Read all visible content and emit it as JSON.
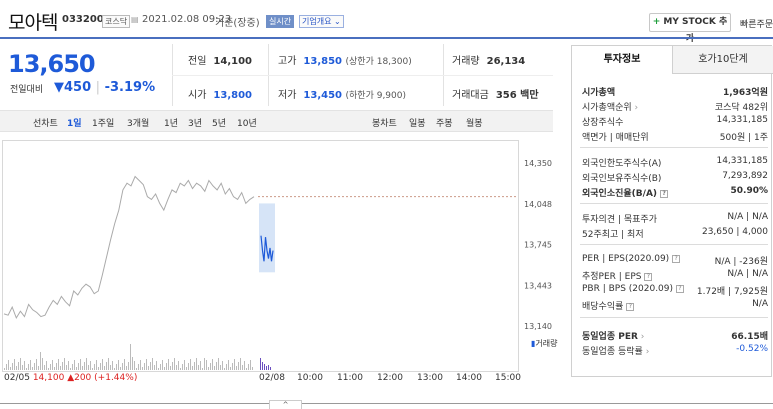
{
  "header": {
    "name": "모아텍",
    "code": "033200",
    "market_badge": "코스닥",
    "datetime": "2021.02.08 09:23",
    "basis": "기준(장중)",
    "realtime_badge": "실시간",
    "overview_badge": "기업개요",
    "my_stock_label": "MY STOCK 추가",
    "quick_order_label": "빠른주문"
  },
  "quote": {
    "price": "13,650",
    "change_label": "전일대비",
    "change_arrow": "▼",
    "change_amount": "450",
    "change_pct": "-3.19%",
    "prev_close_label": "전일",
    "prev_close": "14,100",
    "open_label": "시가",
    "open": "13,800",
    "high_label": "고가",
    "high": "13,850",
    "upper_limit": "(상한가 18,300)",
    "low_label": "저가",
    "low": "13,450",
    "lower_limit": "(하한가 9,900)",
    "volume_label": "거래량",
    "volume": "26,134",
    "amount_label": "거래대금",
    "amount": "356 백만"
  },
  "chart_tabs": {
    "line_label": "선차트",
    "periods": [
      "1일",
      "1주일",
      "3개월",
      "1년",
      "3년",
      "5년",
      "10년"
    ],
    "candle_label": "봉차트",
    "candles": [
      "일봉",
      "주봉",
      "월봉"
    ]
  },
  "chart_data": {
    "type": "line",
    "y_ticks": [
      "14,350",
      "14,048",
      "13,745",
      "13,443",
      "13,140"
    ],
    "ylim": [
      13140,
      14350
    ],
    "x_ticks": [
      "02/08",
      "10:00",
      "11:00",
      "12:00",
      "13:00",
      "14:00",
      "15:00"
    ],
    "volume_label": "거래량",
    "prev_day_label": "02/05",
    "prev_day_close": "14,100",
    "prev_day_change": "▲200",
    "prev_day_pct": "(+1.44%)",
    "reference_price": 14100,
    "series": [
      {
        "values": [
          13230,
          13220,
          13280,
          13200,
          13250,
          13210,
          13300,
          13260,
          13240,
          13210,
          13220,
          13280,
          13330,
          13300,
          13360,
          13320,
          13290,
          13400,
          13370,
          13420,
          13450,
          13430,
          13380,
          13400,
          13520,
          13650,
          13780,
          13900,
          14000,
          14150,
          14200,
          14180,
          14250,
          14220,
          14190,
          14100,
          14080,
          14120,
          14050,
          14000,
          14080,
          14150,
          14130,
          14200,
          14180,
          14220,
          14160,
          14200,
          14180,
          14140,
          14220,
          14180,
          14150,
          14200,
          14120,
          14160,
          14100,
          14080,
          14130,
          14050,
          14080,
          14100
        ]
      },
      {
        "values": [
          13810,
          13700,
          13620,
          13800,
          13700,
          13640,
          13720,
          13620,
          13700
        ]
      }
    ]
  },
  "panel": {
    "tab_invest": "투자정보",
    "tab_order": "호가10단계",
    "market_cap_label": "시가총액",
    "market_cap": "1,963억원",
    "cap_rank_label": "시가총액순위",
    "cap_rank": "코스닥 482위",
    "shares_label": "상장주식수",
    "shares": "14,331,185",
    "par_label": "액면가 | 매매단위",
    "par": "500원 | 1주",
    "foreign_limit_label": "외국인한도주식수(A)",
    "foreign_limit": "14,331,185",
    "foreign_hold_label": "외국인보유주식수(B)",
    "foreign_hold": "7,293,892",
    "foreign_ratio_label": "외국인소진율(B/A)",
    "foreign_ratio": "50.90%",
    "opinion_label": "투자의견 | 목표주가",
    "opinion": "N/A | N/A",
    "range52_label": "52주최고 | 최저",
    "range52": "23,650 | 4,000",
    "per_label": "PER | EPS(2020.09)",
    "per": "N/A | -236원",
    "est_per_label": "추정PER | EPS",
    "est_per": "N/A | N/A",
    "pbr_label": "PBR | BPS (2020.09)",
    "pbr": "1.72배 | 7,925원",
    "div_label": "배당수익률",
    "div": "N/A",
    "sector_per_label": "동일업종 PER",
    "sector_per": "66.15배",
    "sector_rate_label": "동일업종 등락률",
    "sector_rate": "-0.52%"
  },
  "bottom": {
    "handle_glyph": "^"
  }
}
